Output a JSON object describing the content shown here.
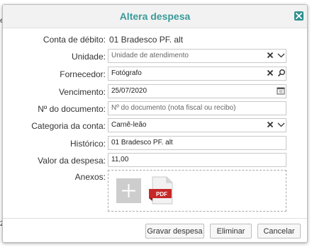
{
  "edge": {
    "top_left": "e",
    "bottom_left": "2"
  },
  "dialog": {
    "title": "Altera despesa",
    "close_icon": "close-x-icon"
  },
  "form": {
    "conta": {
      "label": "Conta de débito:",
      "value": "01 Bradesco PF. alt"
    },
    "unidade": {
      "label": "Unidade:",
      "placeholder": "Unidade de atendimento",
      "value": ""
    },
    "fornecedor": {
      "label": "Fornecedor:",
      "value": "Fotógrafo"
    },
    "vencimento": {
      "label": "Vencimento:",
      "value": "25/07/2020"
    },
    "documento": {
      "label": "Nº do documento:",
      "placeholder": "Nº do documento (nota fiscal ou recibo)",
      "value": ""
    },
    "categoria": {
      "label": "Categoria da conta:",
      "value": "Carnê-leão"
    },
    "historico": {
      "label": "Histórico:",
      "value": "01 Bradesco PF. alt"
    },
    "valor": {
      "label": "Valor da despesa:",
      "value": "11,00"
    },
    "anexos": {
      "label": "Anexos:",
      "pdf_label": "PDF"
    }
  },
  "buttons": {
    "save": "Gravar despesa",
    "delete": "Eliminar",
    "cancel": "Cancelar"
  },
  "colors": {
    "title": "#3a9a9a",
    "close_bg": "#2f8f8f",
    "pdf_red": "#c62828"
  }
}
